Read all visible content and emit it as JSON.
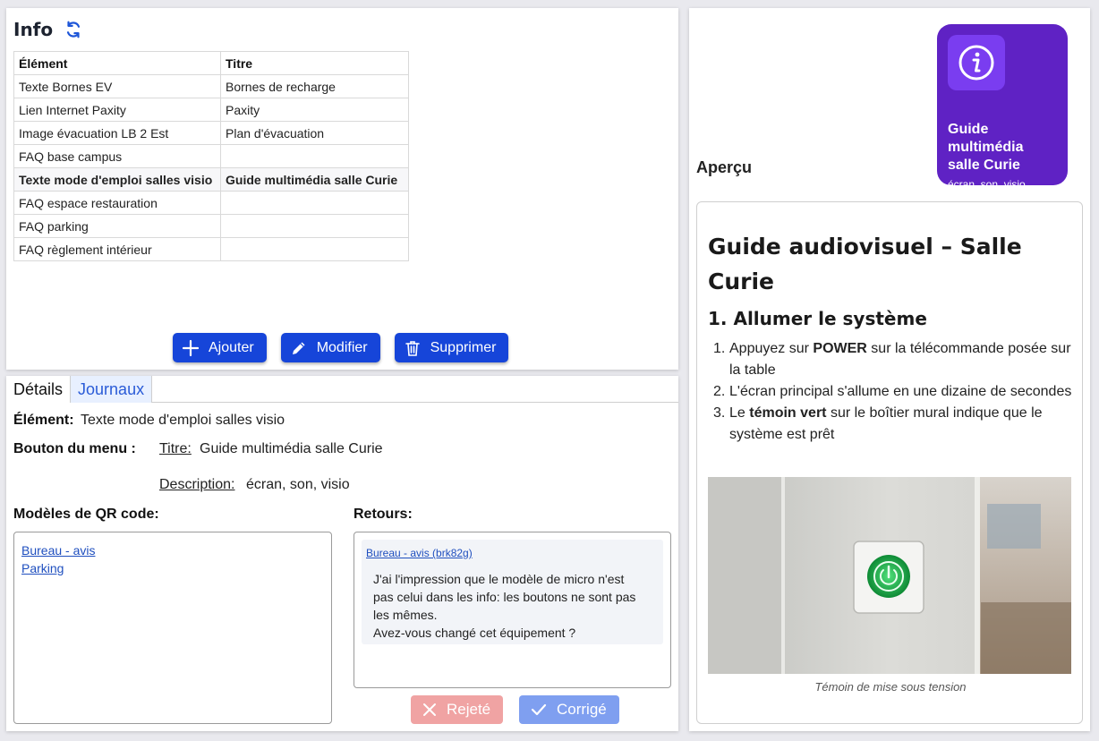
{
  "info": {
    "title": "Info",
    "columns": [
      "Élément",
      "Titre"
    ],
    "rows": [
      {
        "element": "Texte Bornes EV",
        "titre": "Bornes de recharge"
      },
      {
        "element": "Lien Internet Paxity",
        "titre": "Paxity"
      },
      {
        "element": "Image évacuation LB 2 Est",
        "titre": "Plan d'évacuation"
      },
      {
        "element": "FAQ base campus",
        "titre": ""
      },
      {
        "element": "Texte mode d'emploi salles visio",
        "titre": "Guide multimédia salle Curie"
      },
      {
        "element": "FAQ espace restauration",
        "titre": ""
      },
      {
        "element": "FAQ parking",
        "titre": ""
      },
      {
        "element": "FAQ règlement intérieur",
        "titre": ""
      }
    ],
    "buttons": {
      "add": "Ajouter",
      "edit": "Modifier",
      "delete": "Supprimer"
    },
    "accent": "#1645d9"
  },
  "details": {
    "tabs": [
      "Détails",
      "Journaux"
    ],
    "element_label": "Élément:",
    "element_value": "Texte mode d'emploi salles visio",
    "menu_label": "Bouton du menu :",
    "titre_label": "Titre:",
    "titre_value": "Guide multimédia salle Curie",
    "description_label": "Description:",
    "description_value": "écran, son, visio",
    "qr_label": "Modèles de QR code:",
    "qr_links": [
      "Bureau - avis",
      "Parking"
    ],
    "retours_label": "Retours:",
    "feedback": {
      "source": "Bureau - avis (brk82g)",
      "text_lines": [
        "J'ai l'impression que le modèle de micro n'est",
        "pas celui dans les info: les boutons ne sont pas",
        "les mêmes.",
        "Avez-vous changé cet équipement ?"
      ]
    },
    "reject_label": "Rejeté",
    "fixed_label": "Corrigé",
    "reject_color": "#f0a3a3",
    "fixed_color": "#7f9ff0"
  },
  "preview": {
    "label": "Aperçu",
    "tile": {
      "title_lines": [
        "Guide",
        "multimédia",
        "salle Curie"
      ],
      "description": "écran, son, visio",
      "color": "#5f22c4",
      "icon": "info-icon"
    },
    "heading": "Guide audiovisuel – Salle Curie",
    "section": "1. Allumer le système",
    "steps": [
      {
        "num": "1.",
        "before": "Appuyez sur ",
        "bold": "POWER",
        "after": " sur la télécommande posée sur la table"
      },
      {
        "num": "2.",
        "before": "L'écran principal s'allume en une dizaine de secondes",
        "bold": "",
        "after": ""
      },
      {
        "num": "3.",
        "before": "Le ",
        "bold": "témoin vert",
        "after": " sur le boîtier mural indique que le système est prêt"
      }
    ],
    "image_caption": "Témoin de mise sous tension"
  }
}
